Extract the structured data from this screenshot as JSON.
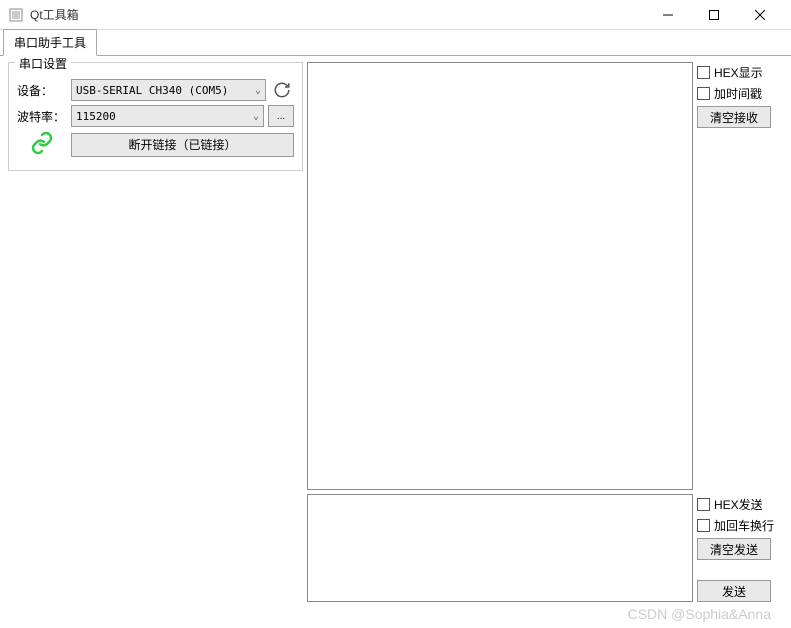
{
  "window": {
    "title": "Qt工具箱"
  },
  "tabs": {
    "main": "串口助手工具"
  },
  "serial": {
    "group_title": "串口设置",
    "device_label": "设备：",
    "device_value": "USB-SERIAL CH340 (COM5)",
    "baud_label": "波特率：",
    "baud_value": "115200",
    "more_label": "...",
    "disconnect_button": "断开链接（已链接）"
  },
  "rx": {
    "hex_display": "HEX显示",
    "add_timestamp": "加时间戳",
    "clear_rx": "清空接收"
  },
  "tx": {
    "hex_send": "HEX发送",
    "add_crlf": "加回车换行",
    "clear_tx": "清空发送",
    "send": "发送"
  },
  "watermark": "CSDN @Sophia&Anna"
}
